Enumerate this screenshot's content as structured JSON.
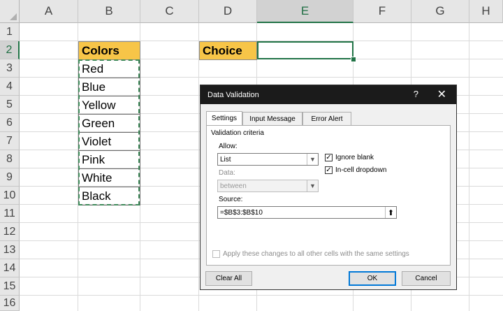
{
  "columns": [
    "A",
    "B",
    "C",
    "D",
    "E",
    "F",
    "G",
    "H"
  ],
  "rows": [
    "1",
    "2",
    "3",
    "4",
    "5",
    "6",
    "7",
    "8",
    "9",
    "10",
    "11",
    "12",
    "13",
    "14",
    "15",
    "16"
  ],
  "cells": {
    "B2": "Colors",
    "D2": "Choice",
    "colors": [
      "Red",
      "Blue",
      "Yellow",
      "Green",
      "Violet",
      "Pink",
      "White",
      "Black"
    ]
  },
  "header_fill_color": "#f7c548",
  "dialog": {
    "title": "Data Validation",
    "help": "?",
    "close": "✕",
    "tabs": [
      "Settings",
      "Input Message",
      "Error Alert"
    ],
    "section": "Validation criteria",
    "allow_label": "Allow:",
    "allow_value": "List",
    "data_label": "Data:",
    "data_value": "between",
    "ignore_blank": "Ignore blank",
    "incell_dropdown": "In-cell dropdown",
    "source_label": "Source:",
    "source_value": "=$B$3:$B$10",
    "apply_text": "Apply these changes to all other cells with the same settings",
    "clear_all": "Clear All",
    "ok": "OK",
    "cancel": "Cancel"
  }
}
